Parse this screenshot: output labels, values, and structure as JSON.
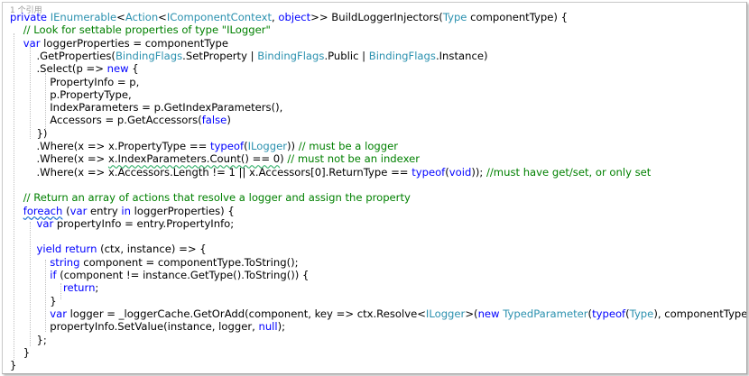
{
  "editor": {
    "colors": {
      "keyword": "#0000ff",
      "type": "#2b91af",
      "comment": "#008000",
      "text": "#000000",
      "background": "#ffffff"
    },
    "lines": [
      [
        {
          "t": "1 个引用",
          "c": "lens"
        }
      ],
      [
        {
          "t": "private ",
          "c": "kw"
        },
        {
          "t": "IEnumerable",
          "c": "ty"
        },
        {
          "t": "<"
        },
        {
          "t": "Action",
          "c": "ty"
        },
        {
          "t": "<"
        },
        {
          "t": "IComponentContext",
          "c": "ty"
        },
        {
          "t": ", "
        },
        {
          "t": "object",
          "c": "kw"
        },
        {
          "t": ">> BuildLoggerInjectors("
        },
        {
          "t": "Type",
          "c": "ty"
        },
        {
          "t": " componentType) {"
        }
      ],
      [
        {
          "t": "    "
        },
        {
          "t": "// Look for settable properties of type \"ILogger\"",
          "c": "cm"
        }
      ],
      [
        {
          "t": "    "
        },
        {
          "t": "var",
          "c": "kw"
        },
        {
          "t": " loggerProperties = componentType"
        }
      ],
      [
        {
          "t": "        .GetProperties("
        },
        {
          "t": "BindingFlags",
          "c": "ty"
        },
        {
          "t": ".SetProperty | "
        },
        {
          "t": "BindingFlags",
          "c": "ty"
        },
        {
          "t": ".Public | "
        },
        {
          "t": "BindingFlags",
          "c": "ty"
        },
        {
          "t": ".Instance)"
        }
      ],
      [
        {
          "t": "        .Select(p => "
        },
        {
          "t": "new",
          "c": "kw"
        },
        {
          "t": " {"
        }
      ],
      [
        {
          "t": "            PropertyInfo = p,"
        }
      ],
      [
        {
          "t": "            p.PropertyType,"
        }
      ],
      [
        {
          "t": "            IndexParameters = p.GetIndexParameters(),"
        }
      ],
      [
        {
          "t": "            Accessors = p.GetAccessors("
        },
        {
          "t": "false",
          "c": "kw"
        },
        {
          "t": ")"
        }
      ],
      [
        {
          "t": "        })"
        }
      ],
      [
        {
          "t": "        .Where(x => x.PropertyType == "
        },
        {
          "t": "typeof",
          "c": "kw"
        },
        {
          "t": "("
        },
        {
          "t": "ILogger",
          "c": "ty"
        },
        {
          "t": ")) "
        },
        {
          "t": "// must be a logger",
          "c": "cm"
        }
      ],
      [
        {
          "t": "        .Where(x => "
        },
        {
          "t": "x.IndexParameters.Count() == 0",
          "c": "sq"
        },
        {
          "t": ") "
        },
        {
          "t": "// must not be an indexer",
          "c": "cm"
        }
      ],
      [
        {
          "t": "        .Where(x => x.Accessors.Length != 1 || x.Accessors[0].ReturnType == "
        },
        {
          "t": "typeof",
          "c": "kw"
        },
        {
          "t": "("
        },
        {
          "t": "void",
          "c": "kw"
        },
        {
          "t": ")); "
        },
        {
          "t": "//must have get/set, or only set",
          "c": "cm"
        }
      ],
      [],
      [
        {
          "t": "    "
        },
        {
          "t": "// Return an array of actions that resolve a logger and assign the property",
          "c": "cm"
        }
      ],
      [
        {
          "t": "    "
        },
        {
          "t": "foreach",
          "c": "kw rb"
        },
        {
          "t": " ("
        },
        {
          "t": "var",
          "c": "kw"
        },
        {
          "t": " entry "
        },
        {
          "t": "in",
          "c": "kw"
        },
        {
          "t": " loggerProperties) {"
        }
      ],
      [
        {
          "t": "        "
        },
        {
          "t": "var",
          "c": "kw"
        },
        {
          "t": " propertyInfo = entry.PropertyInfo;"
        }
      ],
      [],
      [
        {
          "t": "        "
        },
        {
          "t": "yield",
          "c": "kw"
        },
        {
          "t": " "
        },
        {
          "t": "return",
          "c": "kw"
        },
        {
          "t": " (ctx, instance) => {"
        }
      ],
      [
        {
          "t": "            "
        },
        {
          "t": "string",
          "c": "kw"
        },
        {
          "t": " component = componentType.ToString();"
        }
      ],
      [
        {
          "t": "            "
        },
        {
          "t": "if",
          "c": "kw"
        },
        {
          "t": " (component != instance.GetType().ToString()) {"
        }
      ],
      [
        {
          "t": "                "
        },
        {
          "t": "return",
          "c": "kw"
        },
        {
          "t": ";"
        }
      ],
      [
        {
          "t": "            }"
        }
      ],
      [
        {
          "t": "            "
        },
        {
          "t": "var",
          "c": "kw"
        },
        {
          "t": " logger = _loggerCache.GetOrAdd(component, key => ctx.Resolve<"
        },
        {
          "t": "ILogger",
          "c": "ty"
        },
        {
          "t": ">("
        },
        {
          "t": "new",
          "c": "kw"
        },
        {
          "t": " "
        },
        {
          "t": "TypedParameter",
          "c": "ty"
        },
        {
          "t": "("
        },
        {
          "t": "typeof",
          "c": "kw"
        },
        {
          "t": "("
        },
        {
          "t": "Type",
          "c": "ty"
        },
        {
          "t": "), componentType)));"
        }
      ],
      [
        {
          "t": "            propertyInfo.SetValue(instance, logger, "
        },
        {
          "t": "null",
          "c": "kw"
        },
        {
          "t": ");"
        }
      ],
      [
        {
          "t": "        };"
        }
      ],
      [
        {
          "t": "    }"
        }
      ],
      [
        {
          "t": "}"
        }
      ]
    ]
  }
}
